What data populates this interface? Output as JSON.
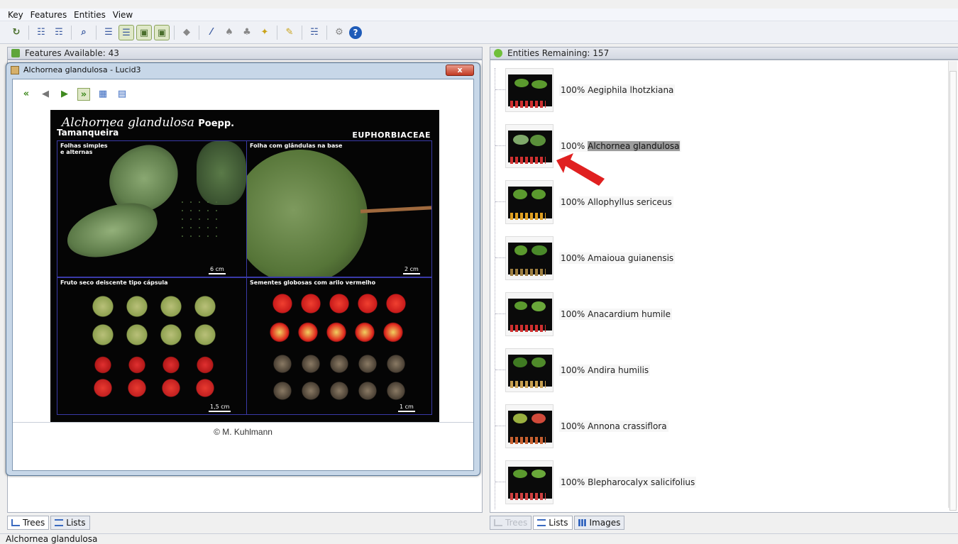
{
  "menu": [
    "Key",
    "Features",
    "Entities",
    "View"
  ],
  "toolbar": {
    "icons": [
      "refresh-icon",
      "tree-icon",
      "tree-expand-icon",
      "find-icon",
      "list-icon",
      "list-selected-icon",
      "image-green-icon",
      "image-selected-icon",
      "tag-icon",
      "wand-icon",
      "best-icon",
      "prune-icon",
      "differences-icon",
      "features-used-icon",
      "entities-list-icon",
      "settings-icon",
      "help-icon"
    ]
  },
  "left_panel": {
    "header": "Features Available: 43",
    "tabs": [
      {
        "label": "Trees"
      },
      {
        "label": "Lists"
      }
    ]
  },
  "right_panel": {
    "header": "Entities Remaining: 157",
    "tabs": [
      {
        "label": "Trees"
      },
      {
        "label": "Lists"
      },
      {
        "label": "Images"
      }
    ]
  },
  "window": {
    "title": "Alchornea glandulosa - Lucid3",
    "close_label": "x",
    "plate": {
      "scientific_name": "Alchornea glandulosa",
      "author": "Poepp.",
      "common_name": "Tamanqueira",
      "family": "EUPHORBIACEAE",
      "q1_label_a": "Folhas simples",
      "q1_label_b": "e alternas",
      "q1_scale": "6 cm",
      "q2_label": "Folha com glândulas na base",
      "q2_scale": "2 cm",
      "q3_label": "Fruto seco deiscente tipo cápsula",
      "q3_scale": "1,5 cm",
      "q4_label": "Sementes globosas com arilo vermelho",
      "q4_scale": "1 cm"
    },
    "credit": "© M. Kuhlmann"
  },
  "entities": [
    {
      "percent": "100%",
      "name": "Aegiphila lhotzkiana",
      "selected": false
    },
    {
      "percent": "100%",
      "name": "Alchornea glandulosa",
      "selected": true
    },
    {
      "percent": "100%",
      "name": "Allophyllus sericeus",
      "selected": false
    },
    {
      "percent": "100%",
      "name": "Amaioua guianensis",
      "selected": false
    },
    {
      "percent": "100%",
      "name": "Anacardium humile",
      "selected": false
    },
    {
      "percent": "100%",
      "name": "Andira humilis",
      "selected": false
    },
    {
      "percent": "100%",
      "name": "Annona crassiflora",
      "selected": false
    },
    {
      "percent": "100%",
      "name": "Blepharocalyx salicifolius",
      "selected": false
    }
  ],
  "status": "Alchornea glandulosa",
  "colors": {
    "accent_green": "#3f8a1f",
    "arrow_red": "#e02020",
    "plate_border": "#3a3aa8"
  }
}
